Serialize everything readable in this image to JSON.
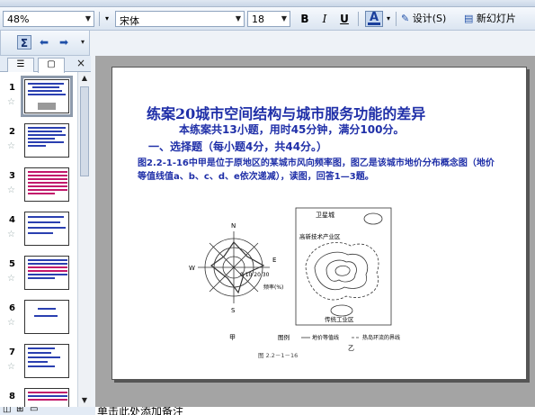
{
  "toolbar": {
    "zoom": "48%",
    "font_name": "宋体",
    "font_size": "18",
    "bold": "B",
    "italic": "I",
    "underline": "U",
    "font_color": "A",
    "design_label": "设计(S)",
    "new_slide_label": "新幻灯片",
    "accent_color": "#1f2fa8"
  },
  "left_panel": {
    "tab_outline": "☰",
    "tab_slides": "▢",
    "close": "×",
    "slides": [
      {
        "num": "1"
      },
      {
        "num": "2"
      },
      {
        "num": "3"
      },
      {
        "num": "4"
      },
      {
        "num": "5"
      },
      {
        "num": "6"
      },
      {
        "num": "7"
      },
      {
        "num": "8"
      }
    ]
  },
  "slide": {
    "title": "练案20城市空间结构与城市服务功能的差异",
    "sub1": "本练案共13小题，用时45分钟，满分100分。",
    "sub2": "一、选择题（每小题4分，共44分。）",
    "para": "图2.2-1-16中甲是位于原地区的某城市风向频率图，图乙是该城市地价分布概念图（地价等值线值a、b、c、d、e依次递减），读图，回答1—3题。",
    "figure": {
      "north": "N",
      "south": "S",
      "west": "W",
      "east": "E",
      "scale": "0 10 20 30",
      "freq_label": "频率(%)",
      "label_jia": "甲",
      "label_yi": "乙",
      "satellite_town": "卫星城",
      "hitech_zone": "高新技术产业区",
      "industry_zone": "传统工业区",
      "legend_title": "图例",
      "legend_contour": "地价等值线",
      "legend_ring": "热岛环流的界线",
      "caption": "图 2.2－1－16"
    }
  },
  "notes": {
    "placeholder": "单击此处添加备注"
  }
}
